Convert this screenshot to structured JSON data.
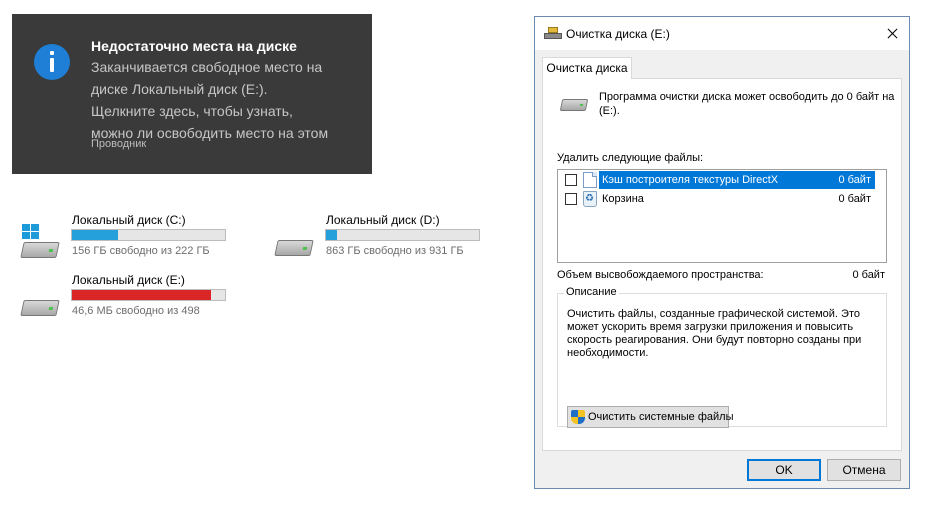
{
  "toast": {
    "icon": "info-icon",
    "accent": "#1f7ed6",
    "title": "Недостаточно места на диске",
    "body_lines": [
      "Заканчивается свободное место на",
      "диске Локальный диск (E:).",
      "Щелкните здесь, чтобы узнать,",
      "можно ли освободить место на этом"
    ],
    "source": "Проводник"
  },
  "drives": [
    {
      "name": "Локальный диск (C:)",
      "free_text": "156 ГБ свободно из 222 ГБ",
      "used_fraction": 0.3,
      "icon": "system-drive-icon",
      "color": "#26a0da"
    },
    {
      "name": "Локальный диск (D:)",
      "free_text": "863 ГБ свободно из 931 ГБ",
      "used_fraction": 0.07,
      "icon": "hard-drive-icon",
      "color": "#26a0da"
    },
    {
      "name": "Локальный диск (E:)",
      "free_text": "46,6 МБ свободно из 498",
      "used_fraction": 0.91,
      "icon": "hard-drive-icon",
      "color": "#da2626"
    }
  ],
  "dialog": {
    "title": "Очистка диска  (E:)",
    "tab_label": "Очистка диска",
    "intro_text": "Программа очистки диска может освободить до 0 байт на  (E:).",
    "files_label": "Удалить следующие файлы:",
    "files": [
      {
        "name": "Кэш построителя текстуры DirectX",
        "size": "0 байт",
        "checked": false,
        "selected": true,
        "icon": "document-icon"
      },
      {
        "name": "Корзина",
        "size": "0 байт",
        "checked": false,
        "selected": false,
        "icon": "recycle-bin-icon"
      }
    ],
    "space_label": "Объем высвобождаемого пространства:",
    "space_value": "0 байт",
    "description_legend": "Описание",
    "description_text": "Очистить файлы, созданные графической системой. Это может ускорить время загрузки приложения и повысить скорость реагирования. Они будут повторно созданы при необходимости.",
    "system_files_button": "Очистить системные файлы",
    "ok_label": "OK",
    "cancel_label": "Отмена"
  }
}
